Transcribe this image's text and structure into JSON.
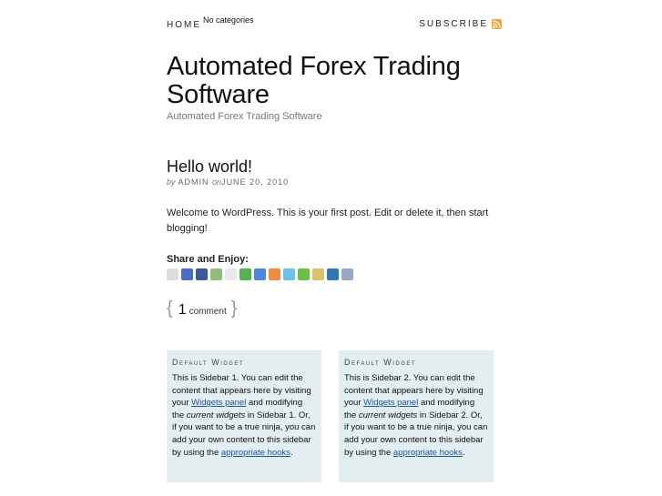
{
  "nav": {
    "home_label": "HOME",
    "categories_label": "No categories",
    "subscribe_label": "SUBSCRIBE"
  },
  "site": {
    "title": "Automated Forex Trading Software",
    "description": "Automated Forex Trading Software"
  },
  "post": {
    "title": "Hello world!",
    "meta_by": "by",
    "author": "ADMIN",
    "meta_on": "on",
    "date": "JUNE 20, 2010",
    "body": "Welcome to WordPress. This is your first post. Edit or delete it, then start blogging!"
  },
  "share": {
    "title": "Share and Enjoy:",
    "icons": [
      {
        "name": "digg-icon",
        "color": "#dcdcdc"
      },
      {
        "name": "delicious-icon",
        "color": "#4a6cc9"
      },
      {
        "name": "facebook-icon",
        "color": "#3b5998"
      },
      {
        "name": "mixx-icon",
        "color": "#8fbf7a"
      },
      {
        "name": "reddit-icon",
        "color": "#e8e8e8"
      },
      {
        "name": "stumbleupon-icon",
        "color": "#56b24c"
      },
      {
        "name": "google-icon",
        "color": "#4c86e0"
      },
      {
        "name": "blogger-icon",
        "color": "#f48a3b"
      },
      {
        "name": "twitter-icon",
        "color": "#6ac2e8"
      },
      {
        "name": "technorati-icon",
        "color": "#6bbf45"
      },
      {
        "name": "live-icon",
        "color": "#d9c36a"
      },
      {
        "name": "linkedin-icon",
        "color": "#2f77b5"
      },
      {
        "name": "yahoo-icon",
        "color": "#9aa8c8"
      }
    ]
  },
  "comments": {
    "brace_open": "{",
    "count": "1",
    "label": "comment",
    "brace_close": "}"
  },
  "widgets": [
    {
      "title": "Default Widget",
      "text_1": "This is Sidebar 1. You can edit the content that appears here by visiting your ",
      "link_1": "Widgets panel",
      "text_2": " and modifying the ",
      "em": "current widgets",
      "text_3": " in Sidebar 1. Or, if you want to be a true ninja, you can add your own content to this sidebar by using the ",
      "link_2": "appropriate hooks",
      "text_4": "."
    },
    {
      "title": "Default Widget",
      "text_1": "This is Sidebar 2. You can edit the content that appears here by visiting your ",
      "link_1": "Widgets panel",
      "text_2": " and modifying the ",
      "em": "current widgets",
      "text_3": " in Sidebar 2. Or, if you want to be a true ninja, you can add your own content to this sidebar by using the ",
      "link_2": "appropriate hooks",
      "text_4": "."
    }
  ]
}
